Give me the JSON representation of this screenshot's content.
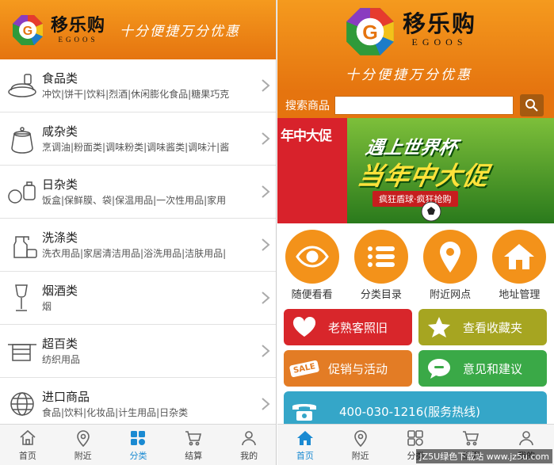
{
  "left_screen": {
    "header": {
      "brand_name": "移乐购",
      "brand_sub": "EGOOS",
      "slogan": "十分便捷万分优惠"
    },
    "categories": [
      {
        "title": "食品类",
        "sub": "冲饮|饼干|饮料|烈酒|休闲膨化食品|糖果巧克"
      },
      {
        "title": "咸杂类",
        "sub": "烹调油|粉面类|调味粉类|调味酱类|调味汁|酱"
      },
      {
        "title": "日杂类",
        "sub": "饭盒|保鲜膜、袋|保温用品|一次性用品|家用"
      },
      {
        "title": "洗涤类",
        "sub": "洗衣用品|家居清洁用品|浴洗用品|洁肤用品|"
      },
      {
        "title": "烟酒类",
        "sub": "烟"
      },
      {
        "title": "超百类",
        "sub": "纺织用品"
      },
      {
        "title": "进口商品",
        "sub": "食品|饮料|化妆品|计生用品|日杂类"
      }
    ],
    "tabs": [
      {
        "label": "首页",
        "icon": "home-icon"
      },
      {
        "label": "附近",
        "icon": "location-pin-icon"
      },
      {
        "label": "分类",
        "icon": "grid-icon"
      },
      {
        "label": "结算",
        "icon": "cart-icon"
      },
      {
        "label": "我的",
        "icon": "user-icon"
      }
    ]
  },
  "right_screen": {
    "header": {
      "brand_name": "移乐购",
      "brand_sub": "EGOOS",
      "slogan": "十分便捷万分优惠"
    },
    "search": {
      "label": "搜索商品",
      "value": ""
    },
    "banner": {
      "left_text": "年中大促",
      "line1": "遇上世界杯",
      "line2": "当年中大促",
      "ribbon": "疯狂盾球·疯狂抢购"
    },
    "quick": [
      {
        "label": "随便看看",
        "icon": "eye-icon"
      },
      {
        "label": "分类目录",
        "icon": "list-icon"
      },
      {
        "label": "附近网点",
        "icon": "location-pin-icon"
      },
      {
        "label": "地址管理",
        "icon": "home-icon"
      }
    ],
    "tiles": {
      "old_customer": "老熟客照旧",
      "favorites": "查看收藏夹",
      "promotions": "促销与活动",
      "feedback": "意见和建议",
      "hotline": "400-030-1216(服务热线)",
      "sale_tag": "SALE"
    },
    "tabs": [
      {
        "label": "首页",
        "icon": "home-icon"
      },
      {
        "label": "附近",
        "icon": "location-pin-icon"
      },
      {
        "label": "分类",
        "icon": "grid-icon"
      },
      {
        "label": "结算",
        "icon": "cart-icon"
      },
      {
        "label": "我的",
        "icon": "user-icon"
      }
    ]
  },
  "watermark": "JZ5U绿色下载站 www.jz5u.com",
  "colors": {
    "orange": "#f3921a",
    "tab_active": "#1a8ad2",
    "tile_red": "#d8262b",
    "tile_olive": "#a6a521",
    "tile_orange": "#e37c25",
    "tile_green": "#3aa947",
    "tile_blue": "#35a6c8"
  }
}
